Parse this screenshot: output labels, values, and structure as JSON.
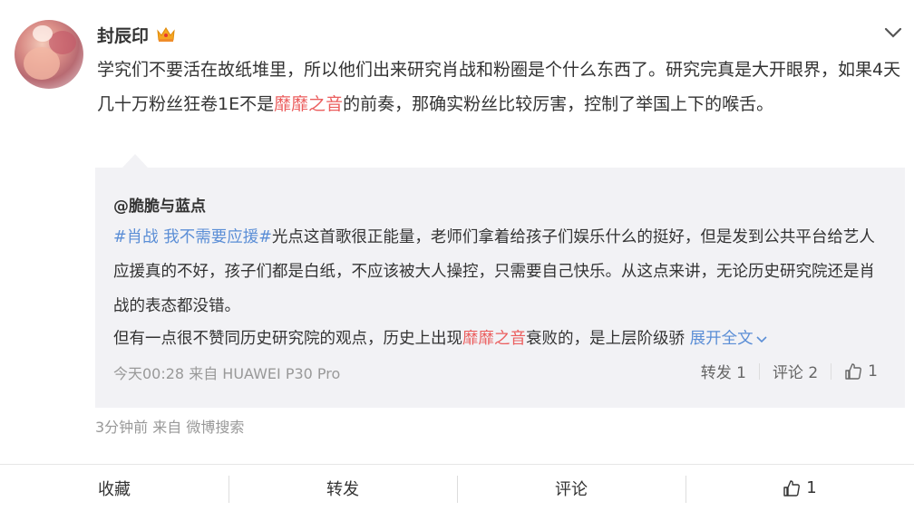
{
  "user": {
    "name": "封辰印",
    "badge_icon": "crown-icon"
  },
  "post": {
    "text_1": "学究们不要活在故纸堆里，所以他们出来研究肖战和粉圈是个什么东西了。研究完真是大开眼界，如果4天几十万粉丝狂卷1E不是",
    "highlight": "靡靡之音",
    "text_2": "的前奏，那确实粉丝比较厉害，控制了举国上下的喉舌。",
    "meta": "3分钟前  来自 微博搜索"
  },
  "repost": {
    "author": "@脆脆与蓝点",
    "topic": "#肖战 我不需要应援#",
    "body": "光点这首歌很正能量，老师们拿着给孩子们娱乐什么的挺好，但是发到公共平台给艺人应援真的不好，孩子们都是白纸，不应该被大人操控，只需要自己快乐。从这点来讲，无论历史研究院还是肖战的表态都没错。",
    "line2_a": "但有一点很不赞同历史研究院的观点，历史上出现",
    "line2_highlight": "靡靡之音",
    "line2_b": "衰败的，是上层阶级骄",
    "expand": "展开全文",
    "meta": "今天00:28 来自 HUAWEI P30 Pro",
    "repost_label": "转发 1",
    "comment_label": "评论 2",
    "like_count": "1"
  },
  "footer": {
    "favorite": "收藏",
    "repost": "转发",
    "comment": "评论",
    "like_count": "1"
  },
  "colors": {
    "highlight_red": "#eb5e5e",
    "link_blue": "#5b8ed6",
    "repost_bg": "#f2f2f5",
    "meta_gray": "#999999"
  }
}
